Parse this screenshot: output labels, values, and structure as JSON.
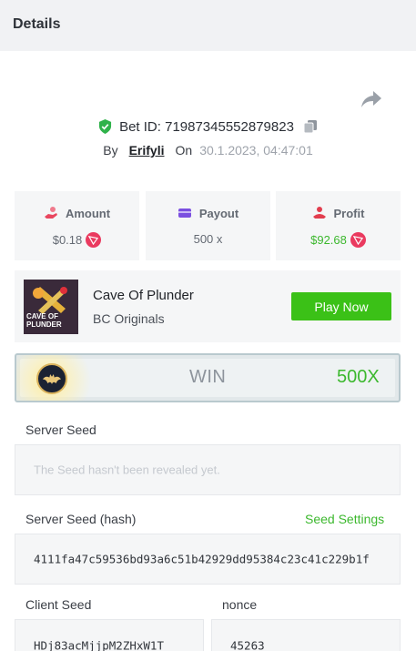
{
  "header": {
    "title": "Details"
  },
  "bet": {
    "id_text": "Bet ID: 71987345552879823",
    "by_label": "By",
    "username": "Erifyli",
    "on_label": "On",
    "datetime": "30.1.2023, 04:47:01"
  },
  "stats": {
    "amount": {
      "label": "Amount",
      "value": "$0.18",
      "icon": "money-hand-icon",
      "color": "#e9465f"
    },
    "payout": {
      "label": "Payout",
      "value": "500 x",
      "icon": "card-icon",
      "color": "#7b4fe0"
    },
    "profit": {
      "label": "Profit",
      "value": "$92.68",
      "icon": "profit-hand-icon",
      "color": "#e23d4e"
    }
  },
  "coin_icon": "tron-coin-icon",
  "game": {
    "name": "Cave Of Plunder",
    "provider": "BC Originals",
    "thumb_label": "CAVE OF PLUNDER",
    "play_label": "Play Now"
  },
  "result": {
    "label": "WIN",
    "multiplier": "500X"
  },
  "server_seed": {
    "label": "Server Seed",
    "placeholder": "The Seed hasn't been revealed yet."
  },
  "server_seed_hash": {
    "label": "Server Seed (hash)",
    "settings_link": "Seed Settings",
    "value": "4111fa47c59536bd93a6c51b42929dd95384c23c41c229b1f"
  },
  "client_seed": {
    "label": "Client Seed",
    "value": "HDj83acMjjpM2ZHxW1T"
  },
  "nonce": {
    "label": "nonce",
    "value": "45263"
  },
  "colors": {
    "accent_green": "#3bc117",
    "tron_red": "#ea3a5f",
    "verified_green": "#2fb24a"
  }
}
